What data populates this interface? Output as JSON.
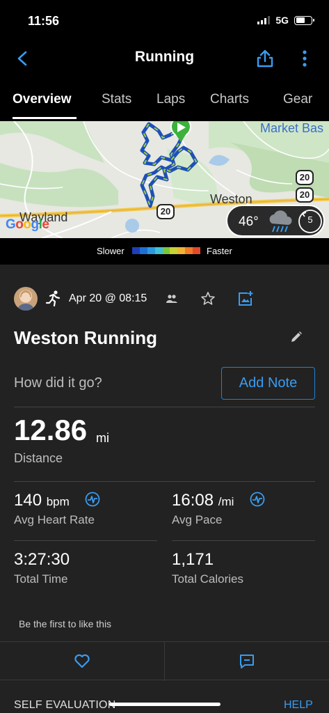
{
  "status_bar": {
    "time": "11:56",
    "network": "5G",
    "battery_level": 0.6
  },
  "header": {
    "title": "Running",
    "back_icon": "chevron-left-icon",
    "share_icon": "share-icon",
    "more_icon": "more-vertical-icon"
  },
  "tabs": [
    {
      "label": "Overview",
      "active": true
    },
    {
      "label": "Stats",
      "active": false
    },
    {
      "label": "Laps",
      "active": false
    },
    {
      "label": "Charts",
      "active": false
    },
    {
      "label": "Gear",
      "active": false
    }
  ],
  "map": {
    "labels": {
      "market": "Market Bas",
      "weston": "Weston",
      "wayland": "Wayland"
    },
    "shields": {
      "route20_a": "20",
      "route20_b": "20",
      "route20_c": "20"
    },
    "attribution": "Google",
    "weather": {
      "temperature": "46°",
      "icon": "rain-cloud-icon",
      "wind_speed": "5"
    }
  },
  "pace_legend": {
    "slower_label": "Slower",
    "faster_label": "Faster",
    "colors": [
      "#1e3fb8",
      "#1f6fd6",
      "#2a9ae0",
      "#3fc1d6",
      "#7bc63a",
      "#c6d332",
      "#f2b233",
      "#f07a2a",
      "#e24a2a"
    ]
  },
  "activity": {
    "date": "Apr 20 @ 08:15",
    "title": "Weston Running",
    "prompt": "How did it go?",
    "add_note_label": "Add Note",
    "distance": {
      "value": "12.86",
      "unit": "mi",
      "label": "Distance"
    },
    "stats": {
      "heart_rate": {
        "value": "140",
        "unit": "bpm",
        "label": "Avg Heart Rate"
      },
      "pace": {
        "value": "16:08",
        "unit": "/mi",
        "label": "Avg Pace"
      },
      "time": {
        "value": "3:27:30",
        "label": "Total Time"
      },
      "calories": {
        "value": "1,171",
        "label": "Total Calories"
      }
    },
    "likes_text": "Be the first to like this",
    "self_evaluation_label": "SELF EVALUATION",
    "help_label": "HELP"
  },
  "colors": {
    "accent": "#3a9cf0",
    "card_bg": "#222222",
    "route_dark": "#1e4fb8",
    "route_light": "#9fd13c",
    "start_marker": "#3cb13c"
  }
}
